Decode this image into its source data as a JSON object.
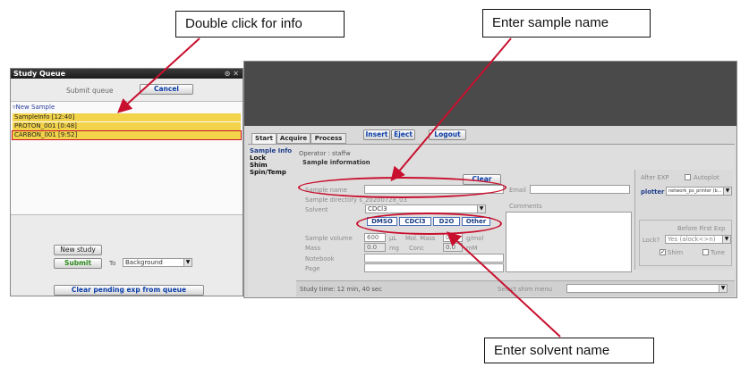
{
  "callouts": {
    "info": "Double click for info",
    "sample": "Enter sample name",
    "solvent": "Enter solvent name"
  },
  "study_queue": {
    "title": "Study Queue",
    "window_controls": "⊙ ✕",
    "submit_label": "Submit queue",
    "cancel": "Cancel",
    "root": "New Sample",
    "items": [
      "SampleInfo [12:40]",
      "PROTON_001 [0:48]",
      "CARBON_001 [9:52]"
    ],
    "new_study": "New study",
    "submit": "Submit",
    "to": "To",
    "background": "Background",
    "clear_pending": "Clear pending exp from queue"
  },
  "toolbar": {
    "insert": "Insert",
    "eject": "Eject",
    "logout": "Logout"
  },
  "tabs": [
    "Start",
    "Acquire",
    "Process"
  ],
  "side_nav": [
    "Sample Info",
    "Lock",
    "Shim",
    "Spin/Temp"
  ],
  "form": {
    "operator": "Operator : staffw",
    "section": "Sample information",
    "clear": "Clear",
    "sample_name_label": "Sample name",
    "email_label": "Email",
    "sample_dir_label": "Sample directory",
    "sample_dir_value": "s_20200728_03",
    "comments_label": "Comments",
    "solvent_label": "Solvent",
    "solvent_value": "CDCl3",
    "solvents": [
      "DMSO",
      "CDCl3",
      "D2O",
      "Other"
    ],
    "sample_volume_label": "Sample volume",
    "sample_volume_value": "600",
    "volume_unit": "μL",
    "mol_mass_label": "Mol. Mass",
    "mol_mass_value": "0.0",
    "mol_mass_unit": "g/mol",
    "mass_label": "Mass",
    "mass_value": "0.0",
    "mass_unit": "mg",
    "conc_label": "Conc",
    "conc_value": "0.0",
    "conc_unit": "mM",
    "notebook_label": "Notebook",
    "page_label": "Page",
    "study_time": "Study time: 12 min, 40 sec",
    "shim_menu": "Select shim menu"
  },
  "right_panel": {
    "after_exp": "After EXP",
    "autoplot": "Autoplot",
    "plotter": "plotter",
    "plotter_value": "network_ps_printer (b...",
    "before_first": "Before First Exp",
    "lock_label": "Lock?",
    "lock_value": "Yes (alock<>n)",
    "shim_check": "Shim",
    "tune_check": "Tune"
  }
}
